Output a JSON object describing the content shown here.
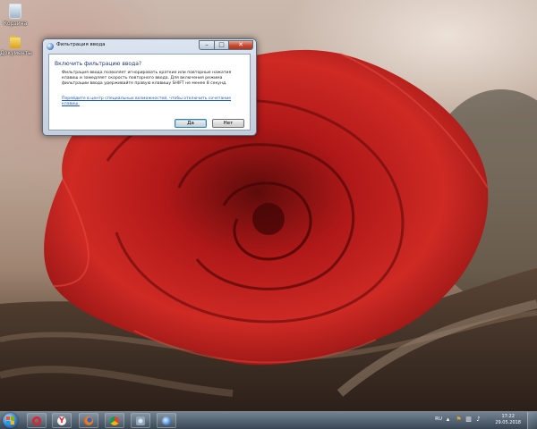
{
  "desktop": {
    "icons": [
      {
        "name": "recycle-bin",
        "label": "Корзина"
      },
      {
        "name": "folder",
        "label": "Документы"
      }
    ]
  },
  "dialog": {
    "title": "Фильтрация ввода",
    "question": "Включить фильтрацию ввода?",
    "description": "Фильтрация ввода позволяет игнорировать краткие или повторные нажатия клавиш и замедляет скорость повторного ввода. Для включения режима фильтрации ввода удерживайте правую клавишу SHIFT не менее 8 секунд.",
    "link": "Перейдите в центр специальных возможностей, чтобы отключить сочетание клавиш.",
    "yes_label": "Да",
    "no_label": "Нет",
    "close_glyph": "✕",
    "maximize_glyph": "□",
    "minimize_glyph": "–"
  },
  "taskbar": {
    "pinned": [
      {
        "name": "opera",
        "color": "#e0202a"
      },
      {
        "name": "yandex-browser",
        "color": "#f2f2f2"
      },
      {
        "name": "firefox",
        "color": "#f08a1c"
      },
      {
        "name": "chrome",
        "color": "#2e9b48"
      },
      {
        "name": "control-panel",
        "color": "#9bb0c4"
      },
      {
        "name": "accessibility",
        "color": "#4b8ad6"
      }
    ],
    "language": "RU",
    "time": "17:22",
    "date": "29.05.2018"
  }
}
